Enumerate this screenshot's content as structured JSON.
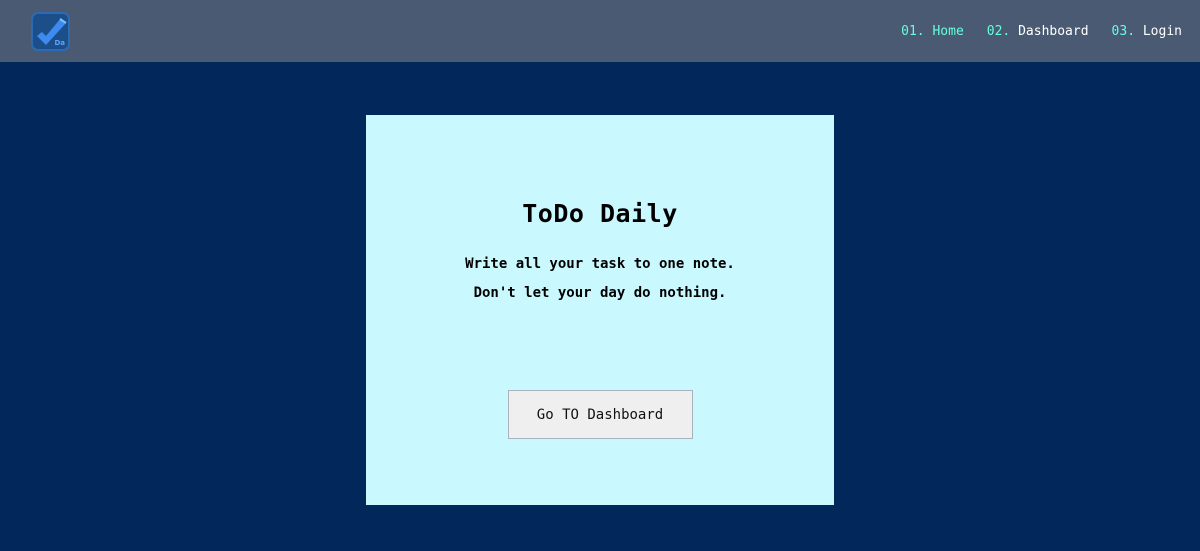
{
  "nav": {
    "logo_text": "Da",
    "links": [
      {
        "num": "01.",
        "label": "Home",
        "active": true
      },
      {
        "num": "02.",
        "label": "Dashboard",
        "active": false
      },
      {
        "num": "03.",
        "label": "Login",
        "active": false
      }
    ]
  },
  "hero": {
    "title": "ToDo Daily",
    "line1": "Write all your task to one note.",
    "line2": "Don't let your day do nothing.",
    "button_label": "Go TO Dashboard"
  },
  "colors": {
    "page_background": "#02285b",
    "navbar_background": "#4a5a73",
    "accent": "#64ffda",
    "card_background": "#caf8ff",
    "button_background": "#efefef"
  },
  "icons": {
    "logo": "pencil-check-icon"
  }
}
